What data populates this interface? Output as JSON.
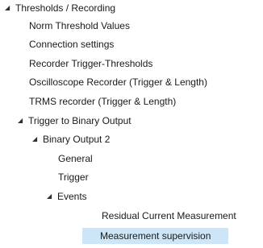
{
  "tree": {
    "items": [
      {
        "label": "Thresholds / Recording",
        "expanded": true
      },
      {
        "label": "Norm Threshold Values"
      },
      {
        "label": "Connection settings"
      },
      {
        "label": "Recorder Trigger-Thresholds"
      },
      {
        "label": "Oscilloscope Recorder (Trigger & Length)"
      },
      {
        "label": "TRMS recorder (Trigger & Length)"
      },
      {
        "label": "Trigger to Binary Output",
        "expanded": true
      },
      {
        "label": "Binary Output 2",
        "expanded": true
      },
      {
        "label": "General"
      },
      {
        "label": "Trigger"
      },
      {
        "label": "Events",
        "expanded": true
      },
      {
        "label": "Residual Current Measurement"
      },
      {
        "label": "Measurement supervision",
        "selected": true
      }
    ],
    "expand_glyph": "◢"
  }
}
